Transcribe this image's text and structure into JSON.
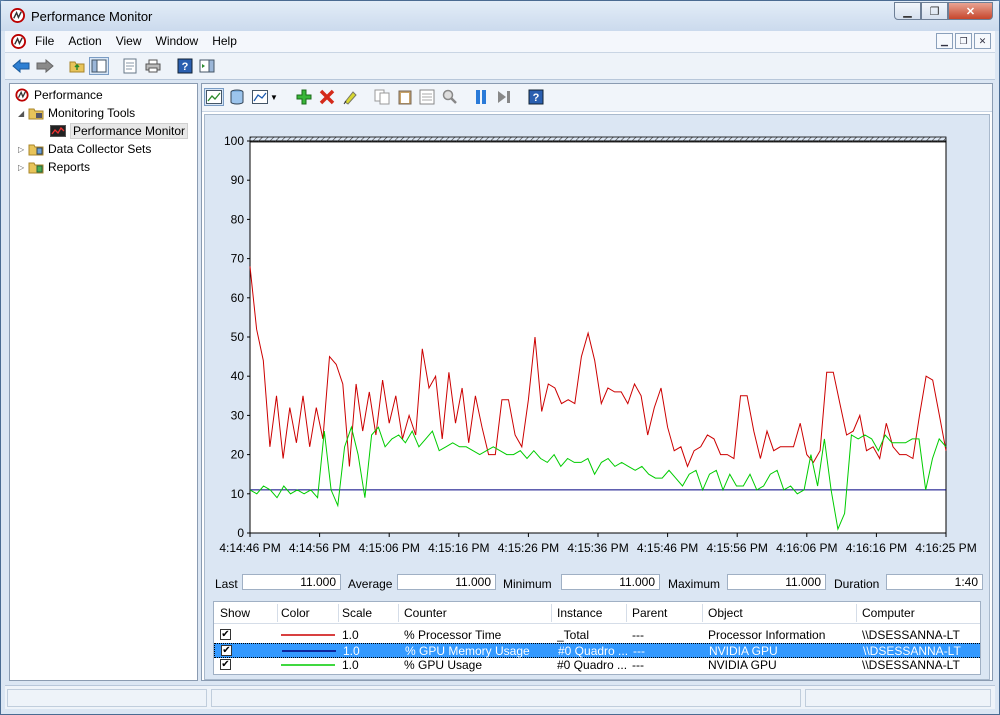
{
  "window": {
    "title": "Performance Monitor"
  },
  "menu": [
    "File",
    "Action",
    "View",
    "Window",
    "Help"
  ],
  "tree": {
    "root": "Performance",
    "items": [
      {
        "label": "Monitoring Tools",
        "expanded": true
      },
      {
        "label": "Performance Monitor",
        "selected": true
      },
      {
        "label": "Data Collector Sets"
      },
      {
        "label": "Reports"
      }
    ]
  },
  "chart_data": {
    "type": "line",
    "ylim": [
      0,
      100
    ],
    "yticks": [
      "100",
      "90",
      "80",
      "70",
      "60",
      "50",
      "40",
      "30",
      "20",
      "10",
      "0"
    ],
    "xticks": [
      "4:14:46 PM",
      "4:14:56 PM",
      "4:15:06 PM",
      "4:15:16 PM",
      "4:15:26 PM",
      "4:15:36 PM",
      "4:15:46 PM",
      "4:15:56 PM",
      "4:16:06 PM",
      "4:16:16 PM",
      "4:16:25 PM"
    ],
    "series": [
      {
        "name": "% Processor Time",
        "color": "#cc0000",
        "values": [
          68,
          52,
          44,
          22,
          35,
          19,
          32,
          23,
          35,
          22,
          32,
          24,
          45,
          43,
          38,
          17,
          38,
          26,
          36,
          25,
          39,
          28,
          35,
          24,
          30,
          25,
          47,
          37,
          40,
          24,
          41,
          28,
          37,
          23,
          35,
          27,
          20,
          20,
          34,
          34,
          25,
          22,
          34,
          50,
          31,
          38,
          37,
          33,
          34,
          33,
          45,
          51,
          44,
          33,
          37,
          36,
          36,
          33,
          38,
          35,
          25,
          32,
          37,
          27,
          21,
          22,
          17,
          21,
          22,
          25,
          24,
          20,
          20,
          19,
          35,
          35,
          26,
          19,
          26,
          21,
          22,
          22,
          22,
          28,
          20,
          18,
          21,
          41,
          41,
          33,
          25,
          26,
          30,
          21,
          22,
          19,
          28,
          22,
          20,
          20,
          19,
          30,
          40,
          39,
          30,
          21
        ]
      },
      {
        "name": "% GPU Memory Usage",
        "color": "#000080",
        "values": [
          11,
          11,
          11,
          11,
          11,
          11,
          11,
          11,
          11,
          11,
          11,
          11,
          11,
          11,
          11,
          11,
          11,
          11,
          11,
          11,
          11,
          11,
          11,
          11,
          11,
          11,
          11,
          11,
          11,
          11,
          11,
          11,
          11,
          11,
          11,
          11,
          11,
          11,
          11,
          11,
          11,
          11,
          11,
          11,
          11,
          11,
          11,
          11,
          11,
          11,
          11,
          11,
          11,
          11,
          11,
          11,
          11,
          11,
          11,
          11,
          11,
          11,
          11,
          11,
          11,
          11,
          11,
          11,
          11,
          11,
          11,
          11,
          11,
          11,
          11,
          11,
          11,
          11,
          11,
          11,
          11,
          11,
          11,
          11,
          11,
          11,
          11,
          11,
          11,
          11,
          11,
          11,
          11,
          11,
          11,
          11,
          11,
          11,
          11,
          11,
          11,
          11,
          11,
          11,
          11,
          11
        ]
      },
      {
        "name": "% GPU Usage",
        "color": "#00cc00",
        "values": [
          11,
          10,
          12,
          11,
          9,
          12,
          10,
          11,
          10,
          11,
          9,
          26,
          11,
          7,
          22,
          27,
          20,
          9,
          25,
          27,
          22,
          24,
          25,
          23,
          26,
          22,
          24,
          26,
          21,
          22,
          23,
          22,
          22,
          21,
          20,
          21,
          22,
          21,
          20,
          20,
          21,
          19,
          21,
          19,
          18,
          20,
          17,
          19,
          18,
          18,
          19,
          15,
          18,
          19,
          17,
          18,
          17,
          16,
          17,
          15,
          14,
          14,
          16,
          14,
          12,
          15,
          16,
          11,
          15,
          16,
          11,
          15,
          12,
          12,
          15,
          11,
          12,
          15,
          16,
          11,
          12,
          10,
          11,
          20,
          12,
          24,
          11,
          1,
          5,
          25,
          24,
          25,
          24,
          21,
          25,
          23,
          23,
          23,
          24,
          24,
          11,
          19,
          24,
          22
        ]
      }
    ]
  },
  "stats": {
    "last_label": "Last",
    "last_value": "11.000",
    "avg_label": "Average",
    "avg_value": "11.000",
    "min_label": "Minimum",
    "min_value": "11.000",
    "max_label": "Maximum",
    "max_value": "11.000",
    "dur_label": "Duration",
    "dur_value": "1:40"
  },
  "legend": {
    "headers": [
      "Show",
      "Color",
      "Scale",
      "Counter",
      "Instance",
      "Parent",
      "Object",
      "Computer"
    ],
    "rows": [
      {
        "scale": "1.0",
        "counter": "% Processor Time",
        "instance": "_Total",
        "parent": "---",
        "object": "Processor Information",
        "computer": "\\\\DSESSANNA-LT",
        "color": "#cc0000",
        "selected": false
      },
      {
        "scale": "1.0",
        "counter": "% GPU Memory Usage",
        "instance": "#0 Quadro ...",
        "parent": "---",
        "object": "NVIDIA GPU",
        "computer": "\\\\DSESSANNA-LT",
        "color": "#000080",
        "selected": true
      },
      {
        "scale": "1.0",
        "counter": "% GPU Usage",
        "instance": "#0 Quadro ...",
        "parent": "---",
        "object": "NVIDIA GPU",
        "computer": "\\\\DSESSANNA-LT",
        "color": "#00cc00",
        "selected": false
      }
    ]
  }
}
